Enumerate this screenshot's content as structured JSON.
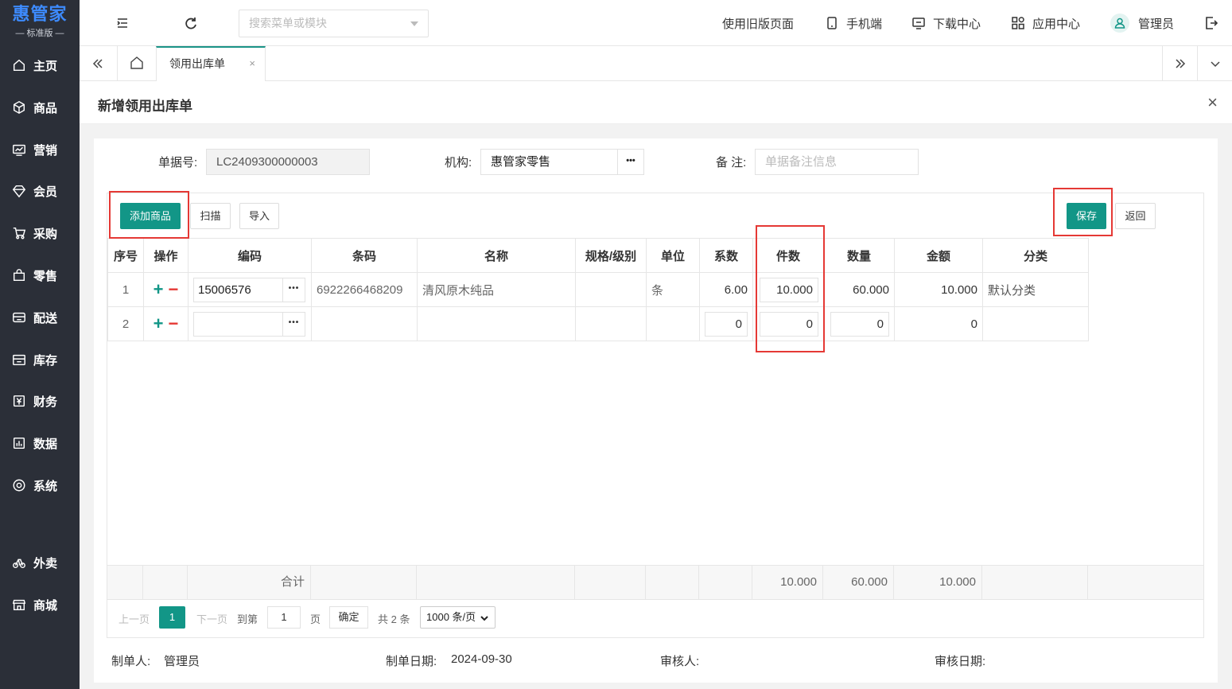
{
  "brand": {
    "title": "惠管家",
    "subtitle": "— 标准版 —"
  },
  "sidebar": {
    "items": [
      {
        "label": "主页",
        "icon": "home-icon"
      },
      {
        "label": "商品",
        "icon": "cube-icon"
      },
      {
        "label": "营销",
        "icon": "chart-icon"
      },
      {
        "label": "会员",
        "icon": "diamond-icon"
      },
      {
        "label": "采购",
        "icon": "cart-icon"
      },
      {
        "label": "零售",
        "icon": "bag-icon"
      },
      {
        "label": "配送",
        "icon": "delivery-icon"
      },
      {
        "label": "库存",
        "icon": "warehouse-icon"
      },
      {
        "label": "财务",
        "icon": "yen-icon"
      },
      {
        "label": "数据",
        "icon": "data-icon"
      },
      {
        "label": "系统",
        "icon": "target-icon"
      },
      {
        "label": "外卖",
        "icon": "bike-icon"
      },
      {
        "label": "商城",
        "icon": "store-icon"
      }
    ]
  },
  "topbar": {
    "search_placeholder": "搜索菜单或模块",
    "old_page": "使用旧版页面",
    "mobile": "手机端",
    "download": "下载中心",
    "apps": "应用中心",
    "user": "管理员"
  },
  "tabs": {
    "active": "领用出库单",
    "close": "×"
  },
  "page": {
    "title": "新增领用出库单",
    "close": "×"
  },
  "form": {
    "doc_no_label": "单据号:",
    "doc_no": "LC2409300000003",
    "org_label": "机构:",
    "org": "惠管家零售",
    "remark_label": "备 注:",
    "remark_placeholder": "单据备注信息"
  },
  "buttons": {
    "add": "添加商品",
    "scan": "扫描",
    "import": "导入",
    "save": "保存",
    "back": "返回",
    "more": "•••"
  },
  "table": {
    "columns": [
      "序号",
      "操作",
      "编码",
      "条码",
      "名称",
      "规格/级别",
      "单位",
      "系数",
      "件数",
      "数量",
      "金额",
      "分类"
    ],
    "rows": [
      {
        "no": "1",
        "code": "15006576",
        "barcode": "6922266468209",
        "name": "清风原木纯品",
        "spec": "",
        "unit": "条",
        "factor": "6.00",
        "pieces": "10.000",
        "qty": "60.000",
        "amount": "10.000",
        "category": "默认分类"
      },
      {
        "no": "2",
        "code": "",
        "barcode": "",
        "name": "",
        "spec": "",
        "unit": "",
        "factor": "0",
        "pieces": "0",
        "qty": "0",
        "amount": "0",
        "category": ""
      }
    ],
    "sum_label": "合计",
    "sum_pieces": "10.000",
    "sum_qty": "60.000",
    "sum_amount": "10.000"
  },
  "pager": {
    "prev": "上一页",
    "current": "1",
    "next": "下一页",
    "goto": "到第",
    "page_input": "1",
    "page_unit": "页",
    "confirm": "确定",
    "total": "共 2 条",
    "page_size": "1000 条/页"
  },
  "footer": {
    "maker_label": "制单人:",
    "maker": "管理员",
    "date_label": "制单日期:",
    "date": "2024-09-30",
    "auditor_label": "审核人:",
    "audit_date_label": "审核日期:"
  },
  "colors": {
    "sidebar": "#2b2f38",
    "accent": "#129687",
    "highlight": "#e53935",
    "brand": "#3d8bff"
  }
}
